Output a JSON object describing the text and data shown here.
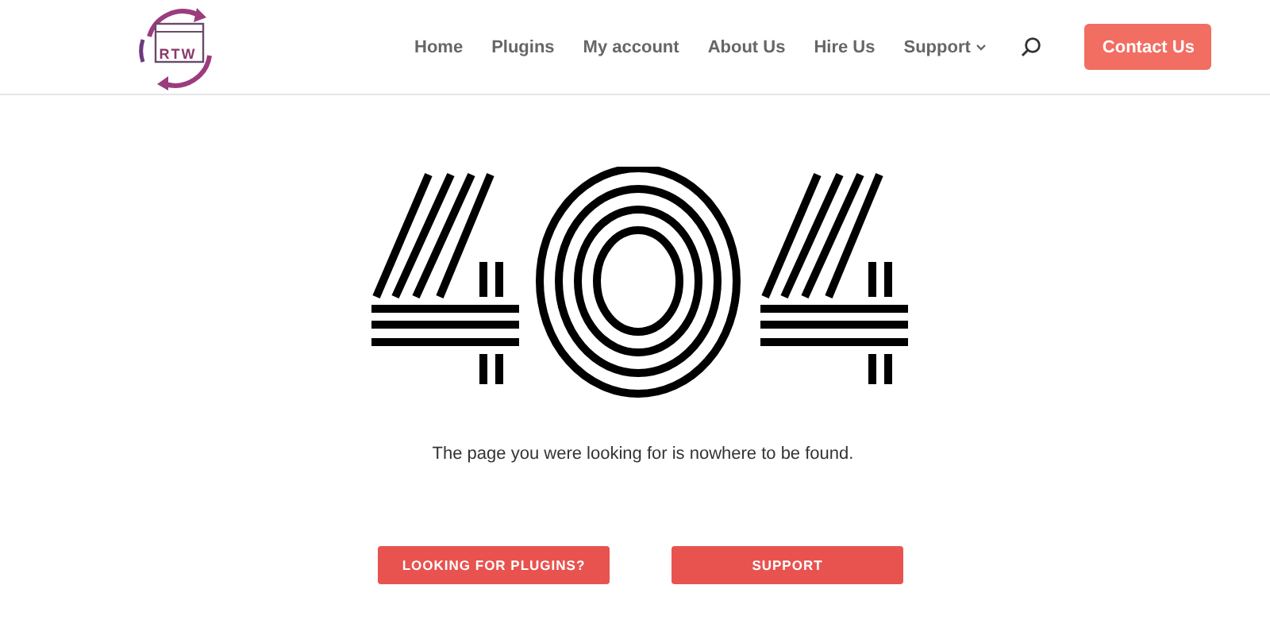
{
  "header": {
    "logo": {
      "text": "RTW"
    },
    "nav": [
      {
        "label": "Home",
        "dropdown": false
      },
      {
        "label": "Plugins",
        "dropdown": false
      },
      {
        "label": "My account",
        "dropdown": false
      },
      {
        "label": "About Us",
        "dropdown": false
      },
      {
        "label": "Hire Us",
        "dropdown": false
      },
      {
        "label": "Support",
        "dropdown": true
      }
    ],
    "cta": "Contact Us"
  },
  "main": {
    "message": "The page you were looking for is nowhere to be found.",
    "buttons": [
      "LOOKING FOR PLUGINS?",
      "SUPPORT"
    ]
  }
}
